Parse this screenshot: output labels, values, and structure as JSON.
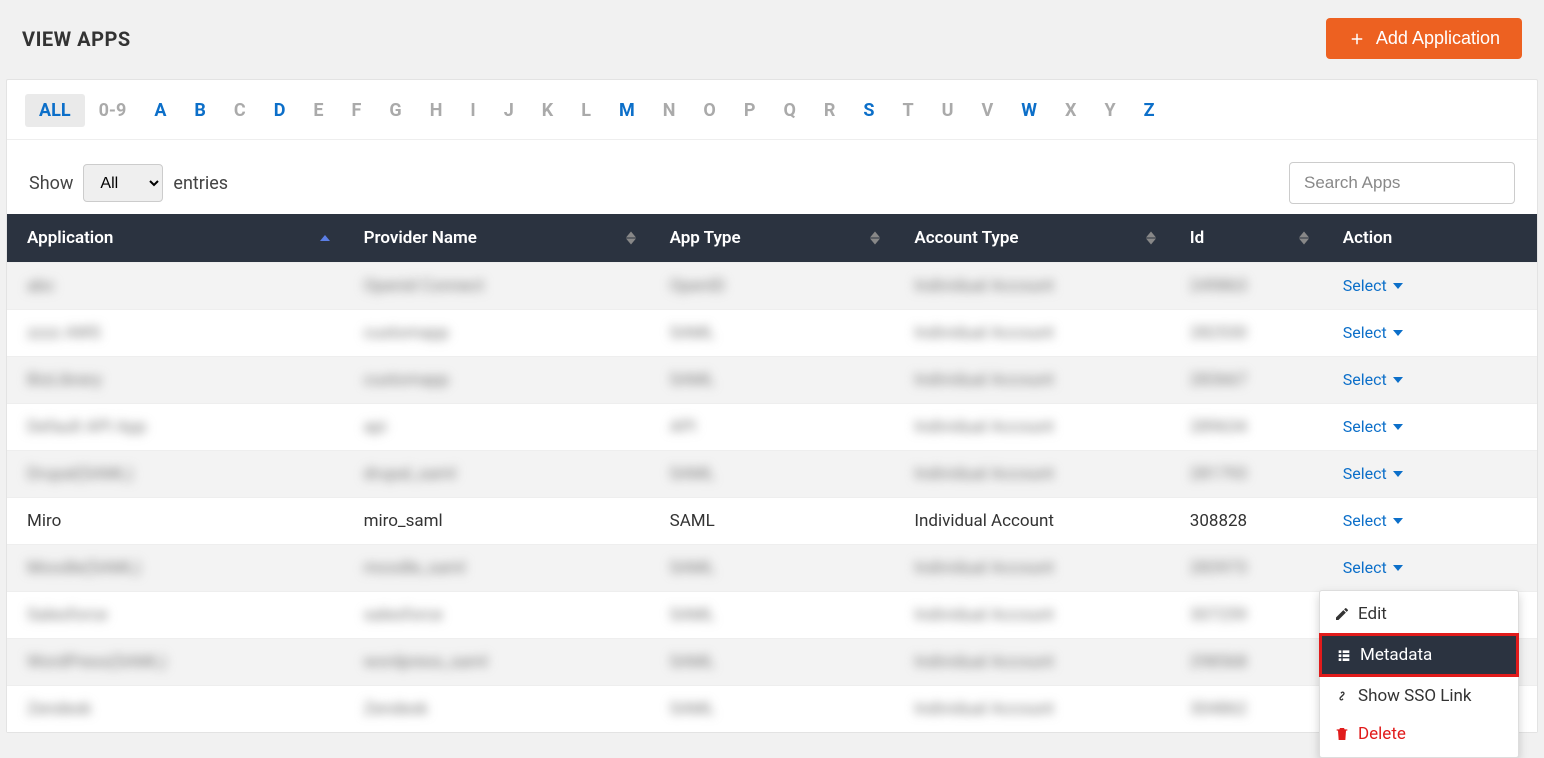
{
  "header": {
    "title": "VIEW APPS",
    "add_button": "Add Application"
  },
  "alpha": {
    "items": [
      {
        "label": "ALL",
        "active": true,
        "link": true
      },
      {
        "label": "0-9"
      },
      {
        "label": "A",
        "link": true
      },
      {
        "label": "B",
        "link": true
      },
      {
        "label": "C"
      },
      {
        "label": "D",
        "link": true
      },
      {
        "label": "E"
      },
      {
        "label": "F"
      },
      {
        "label": "G"
      },
      {
        "label": "H"
      },
      {
        "label": "I"
      },
      {
        "label": "J"
      },
      {
        "label": "K"
      },
      {
        "label": "L"
      },
      {
        "label": "M",
        "link": true
      },
      {
        "label": "N"
      },
      {
        "label": "O"
      },
      {
        "label": "P"
      },
      {
        "label": "Q"
      },
      {
        "label": "R"
      },
      {
        "label": "S",
        "link": true
      },
      {
        "label": "T"
      },
      {
        "label": "U"
      },
      {
        "label": "V"
      },
      {
        "label": "W",
        "link": true
      },
      {
        "label": "X"
      },
      {
        "label": "Y"
      },
      {
        "label": "Z",
        "link": true
      }
    ]
  },
  "controls": {
    "show_label": "Show",
    "show_value": "All",
    "entries_label": "entries",
    "search_placeholder": "Search Apps"
  },
  "columns": {
    "application": "Application",
    "provider": "Provider Name",
    "apptype": "App Type",
    "account": "Account Type",
    "id": "Id",
    "action": "Action"
  },
  "rows": [
    {
      "app": "abc",
      "provider": "Openid Connect",
      "type": "OpenID",
      "account": "Individual Account",
      "id": "249863",
      "blurred": true
    },
    {
      "app": "zzzz AWS",
      "provider": "customapp",
      "type": "SAML",
      "account": "Individual Account",
      "id": "282530",
      "blurred": true
    },
    {
      "app": "BizLibrary",
      "provider": "customapp",
      "type": "SAML",
      "account": "Individual Account",
      "id": "283667",
      "blurred": true
    },
    {
      "app": "Default API App",
      "provider": "api",
      "type": "API",
      "account": "Individual Account",
      "id": "289634",
      "blurred": true
    },
    {
      "app": "Drupal(SAML)",
      "provider": "drupal_saml",
      "type": "SAML",
      "account": "Individual Account",
      "id": "281793",
      "blurred": true
    },
    {
      "app": "Miro",
      "provider": "miro_saml",
      "type": "SAML",
      "account": "Individual Account",
      "id": "308828",
      "blurred": false
    },
    {
      "app": "Moodle(SAML)",
      "provider": "moodle_saml",
      "type": "SAML",
      "account": "Individual Account",
      "id": "283973",
      "blurred": true
    },
    {
      "app": "Salesforce",
      "provider": "salesforce",
      "type": "SAML",
      "account": "Individual Account",
      "id": "307259",
      "blurred": true
    },
    {
      "app": "WordPress(SAML)",
      "provider": "wordpress_saml",
      "type": "SAML",
      "account": "Individual Account",
      "id": "298568",
      "blurred": true
    },
    {
      "app": "Zendesk",
      "provider": "Zendesk",
      "type": "SAML",
      "account": "Individual Account",
      "id": "304862",
      "blurred": true
    }
  ],
  "action_label": "Select",
  "dropdown": {
    "edit": "Edit",
    "metadata": "Metadata",
    "show_sso": "Show SSO Link",
    "delete": "Delete"
  }
}
